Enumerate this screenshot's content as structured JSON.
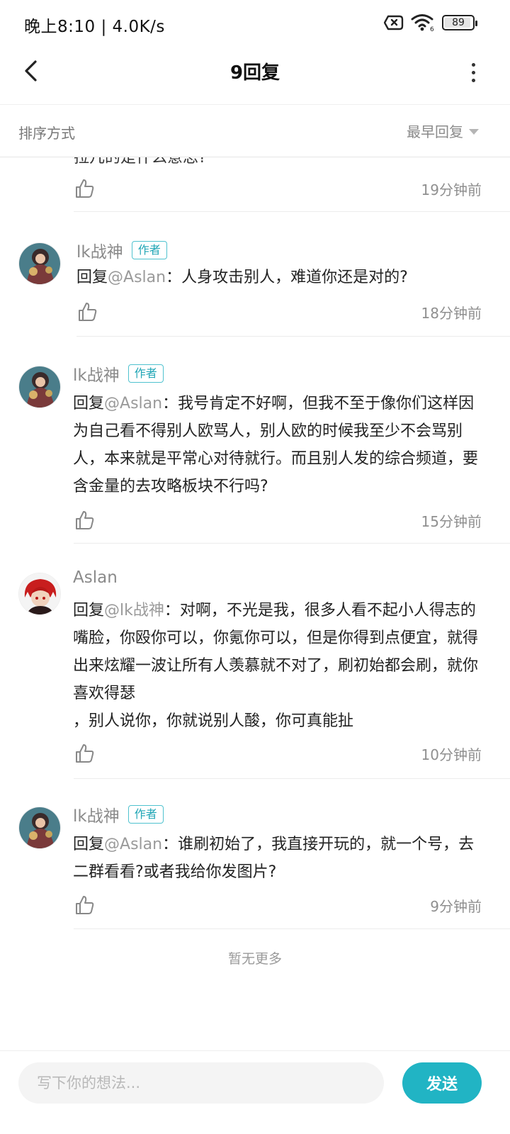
{
  "status_bar": {
    "time_speed": "晚上8:10 | 4.0K/s",
    "battery": "89",
    "wifi_badge": "6"
  },
  "header": {
    "title": "9回复"
  },
  "sort": {
    "label": "排序方式",
    "selected": "最早回复"
  },
  "partial_item": {
    "text": "拉几的是什么意思?",
    "time": "19分钟前"
  },
  "comments": [
    {
      "username": "lk战神",
      "badge": "作者",
      "prefix": "回复",
      "mention": "@Aslan",
      "text": "：人身攻击别人，难道你还是对的?",
      "time": "18分钟前"
    },
    {
      "username": "lk战神",
      "badge": "作者",
      "prefix": "回复",
      "mention": "@Aslan",
      "text": "：我号肯定不好啊，但我不至于像你们这样因为自己看不得别人欧骂人，别人欧的时候我至少不会骂别人，本来就是平常心对待就行。而且别人发的综合频道，要含金量的去攻略板块不行吗?",
      "time": "15分钟前"
    },
    {
      "username": "Aslan",
      "badge": "",
      "prefix": "回复",
      "mention": "@lk战神",
      "text": "：对啊，不光是我，很多人看不起小人得志的嘴脸，你殴你可以，你氪你可以，但是你得到点便宜，就得出来炫耀一波让所有人羡慕就不对了，刷初始都会刷，就你喜欢得瑟",
      "text2": "，别人说你，你就说别人酸，你可真能扯",
      "time": "10分钟前"
    },
    {
      "username": "lk战神",
      "badge": "作者",
      "prefix": "回复",
      "mention": "@Aslan",
      "text": "：谁刷初始了，我直接开玩的，就一个号，去二群看看?或者我给你发图片?",
      "time": "9分钟前"
    }
  ],
  "no_more": "暂无更多",
  "composer": {
    "placeholder": "写下你的想法...",
    "send_label": "发送"
  },
  "colors": {
    "accent": "#21b4c4",
    "badge": "#21a6b6",
    "muted": "#8a8a8a"
  }
}
